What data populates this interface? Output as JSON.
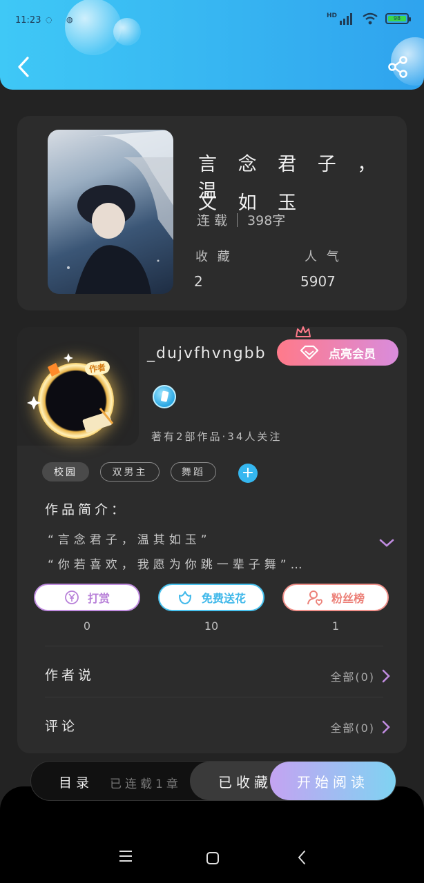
{
  "status_bar": {
    "time": "11:23",
    "network": "HD",
    "battery": "98"
  },
  "book": {
    "title_line1": "言 念 君 子 ， 温",
    "title_line2": "文 如 玉",
    "status": "连 载",
    "word_count": "398字",
    "favorites_label": "收 藏",
    "favorites_value": "2",
    "popularity_label": "人 气",
    "popularity_value": "5907"
  },
  "author": {
    "badge": "作者",
    "name": "_dujvfhvngbb",
    "vip_label": "点亮会员",
    "stats": "著有2部作品·34人关注",
    "tags": [
      "校园",
      "双男主",
      "舞蹈"
    ],
    "intro_title": "作品简介：",
    "intro_line1": "“言念君子，温其如玉”",
    "intro_line2": "“你若喜欢，我愿为你跳一辈子舞”…"
  },
  "actions": [
    {
      "label": "打赏",
      "count": "0",
      "icon": "yen-icon"
    },
    {
      "label": "免费送花",
      "count": "10",
      "icon": "flower-icon"
    },
    {
      "label": "粉丝榜",
      "count": "1",
      "icon": "user-heart-icon"
    }
  ],
  "sections": {
    "author_says": {
      "title": "作者说",
      "right": "全部(0)"
    },
    "comments": {
      "title": "评论",
      "right": "全部(0)"
    }
  },
  "bottom_bar": {
    "toc": "目录",
    "updates": "已连载1章",
    "collected": "已收藏",
    "start_read": "开始阅读"
  },
  "colors": {
    "header": "#38b8f2",
    "vip": "#ff7a8a",
    "reward": "#c08ce0",
    "flower": "#48c2ef",
    "fans": "#f0908a",
    "arrow": "#c08ce0"
  }
}
